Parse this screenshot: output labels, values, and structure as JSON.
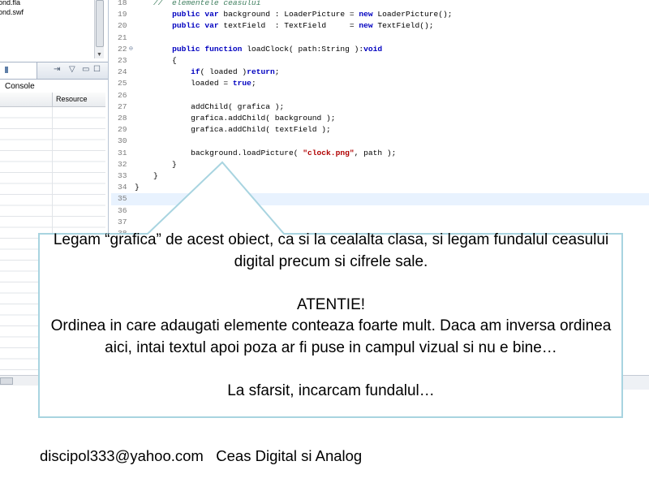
{
  "explorer": {
    "files": [
      "ond.fla",
      "ond.swf"
    ]
  },
  "console_panel": {
    "tab_label": "Console",
    "column_resource": "Resource"
  },
  "editor": {
    "lines": [
      {
        "num": "18",
        "tokens": [
          {
            "t": "    "
          },
          {
            "t": "//  elementele ceasului",
            "c": "cm"
          }
        ]
      },
      {
        "num": "19",
        "tokens": [
          {
            "t": "        "
          },
          {
            "t": "public",
            "c": "kw"
          },
          {
            "t": " "
          },
          {
            "t": "var",
            "c": "kw"
          },
          {
            "t": " background : LoaderPicture = "
          },
          {
            "t": "new",
            "c": "kw"
          },
          {
            "t": " LoaderPicture();"
          }
        ]
      },
      {
        "num": "20",
        "tokens": [
          {
            "t": "        "
          },
          {
            "t": "public",
            "c": "kw"
          },
          {
            "t": " "
          },
          {
            "t": "var",
            "c": "kw"
          },
          {
            "t": " textField  : TextField     = "
          },
          {
            "t": "new",
            "c": "kw"
          },
          {
            "t": " TextField();"
          }
        ]
      },
      {
        "num": "21",
        "tokens": [
          {
            "t": ""
          }
        ]
      },
      {
        "num": "22",
        "fold": true,
        "tokens": [
          {
            "t": "        "
          },
          {
            "t": "public",
            "c": "kw"
          },
          {
            "t": " "
          },
          {
            "t": "function",
            "c": "kw"
          },
          {
            "t": " loadClock( path:String ):"
          },
          {
            "t": "void",
            "c": "kw"
          }
        ]
      },
      {
        "num": "23",
        "tokens": [
          {
            "t": "        {"
          }
        ]
      },
      {
        "num": "24",
        "tokens": [
          {
            "t": "            "
          },
          {
            "t": "if",
            "c": "kw"
          },
          {
            "t": "( loaded )"
          },
          {
            "t": "return",
            "c": "kw"
          },
          {
            "t": ";"
          }
        ]
      },
      {
        "num": "25",
        "tokens": [
          {
            "t": "            loaded = "
          },
          {
            "t": "true",
            "c": "kw"
          },
          {
            "t": ";"
          }
        ]
      },
      {
        "num": "26",
        "tokens": [
          {
            "t": ""
          }
        ]
      },
      {
        "num": "27",
        "tokens": [
          {
            "t": "            addChild( grafica );"
          }
        ]
      },
      {
        "num": "28",
        "tokens": [
          {
            "t": "            grafica.addChild( background );"
          }
        ]
      },
      {
        "num": "29",
        "tokens": [
          {
            "t": "            grafica.addChild( textField );"
          }
        ]
      },
      {
        "num": "30",
        "tokens": [
          {
            "t": ""
          }
        ]
      },
      {
        "num": "31",
        "tokens": [
          {
            "t": "            background.loadPicture( "
          },
          {
            "t": "\"clock.png\"",
            "c": "str"
          },
          {
            "t": ", path );"
          }
        ]
      },
      {
        "num": "32",
        "tokens": [
          {
            "t": "        }"
          }
        ]
      },
      {
        "num": "33",
        "tokens": [
          {
            "t": "    }"
          }
        ]
      },
      {
        "num": "34",
        "tokens": [
          {
            "t": "}"
          }
        ]
      },
      {
        "num": "35",
        "current": true,
        "tokens": [
          {
            "t": ""
          }
        ]
      },
      {
        "num": "36",
        "tokens": [
          {
            "t": ""
          }
        ]
      },
      {
        "num": "37",
        "tokens": [
          {
            "t": ""
          }
        ]
      },
      {
        "num": "38",
        "tokens": [
          {
            "t": ""
          }
        ]
      }
    ]
  },
  "callout": {
    "paragraph1": "Legam “grafica” de acest obiect, ca si la cealalta clasa, si legam fundalul ceasului digital precum si cifrele sale.",
    "warning_title": "ATENTIE!",
    "paragraph2": "Ordinea in care adaugati elemente conteaza foarte mult. Daca am inversa ordinea aici, intai textul apoi poza ar fi puse in campul vizual si nu e bine…",
    "paragraph3": "La sfarsit, incarcam fundalul…",
    "border_color": "#a8d4e0"
  },
  "footer": {
    "email": "discipol333@yahoo.com",
    "title": "Ceas Digital si Analog"
  }
}
